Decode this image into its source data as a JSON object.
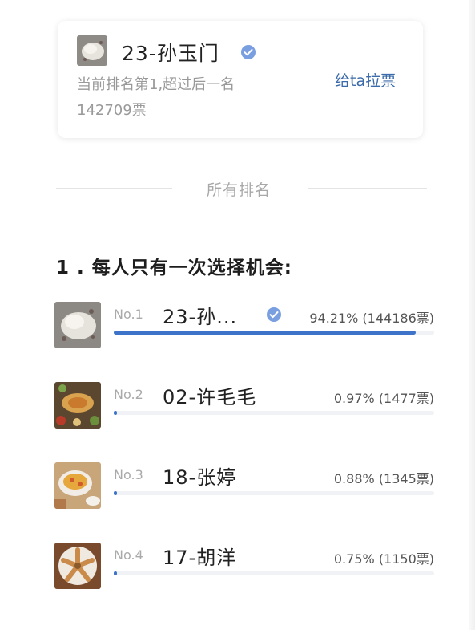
{
  "card": {
    "name": "23-孙玉门",
    "subtitle": "当前排名第1,超过后一名142709票",
    "button_label": "给ta拉票"
  },
  "divider_label": "所有排名",
  "question": "1 . 每人只有一次选择机会:",
  "candidates": [
    {
      "rank": "No.1",
      "name": "23-孙...",
      "verified": true,
      "percent_text": "94.21% (144186票)",
      "fraction": 0.9421,
      "avatar": "dish-cloth-icon"
    },
    {
      "rank": "No.2",
      "name": "02-许毛毛",
      "verified": false,
      "percent_text": "0.97% (1477票)",
      "fraction": 0.0097,
      "avatar": "food-platter-icon"
    },
    {
      "rank": "No.3",
      "name": "18-张婷",
      "verified": false,
      "percent_text": "0.88% (1345票)",
      "fraction": 0.0088,
      "avatar": "food-bowl-icon"
    },
    {
      "rank": "No.4",
      "name": "17-胡洋",
      "verified": false,
      "percent_text": "0.75% (1150票)",
      "fraction": 0.0075,
      "avatar": "star-dish-icon"
    }
  ],
  "colors": {
    "accent": "#3d73c8",
    "link": "#3a6aa8",
    "verified": "#7a9fe0"
  }
}
